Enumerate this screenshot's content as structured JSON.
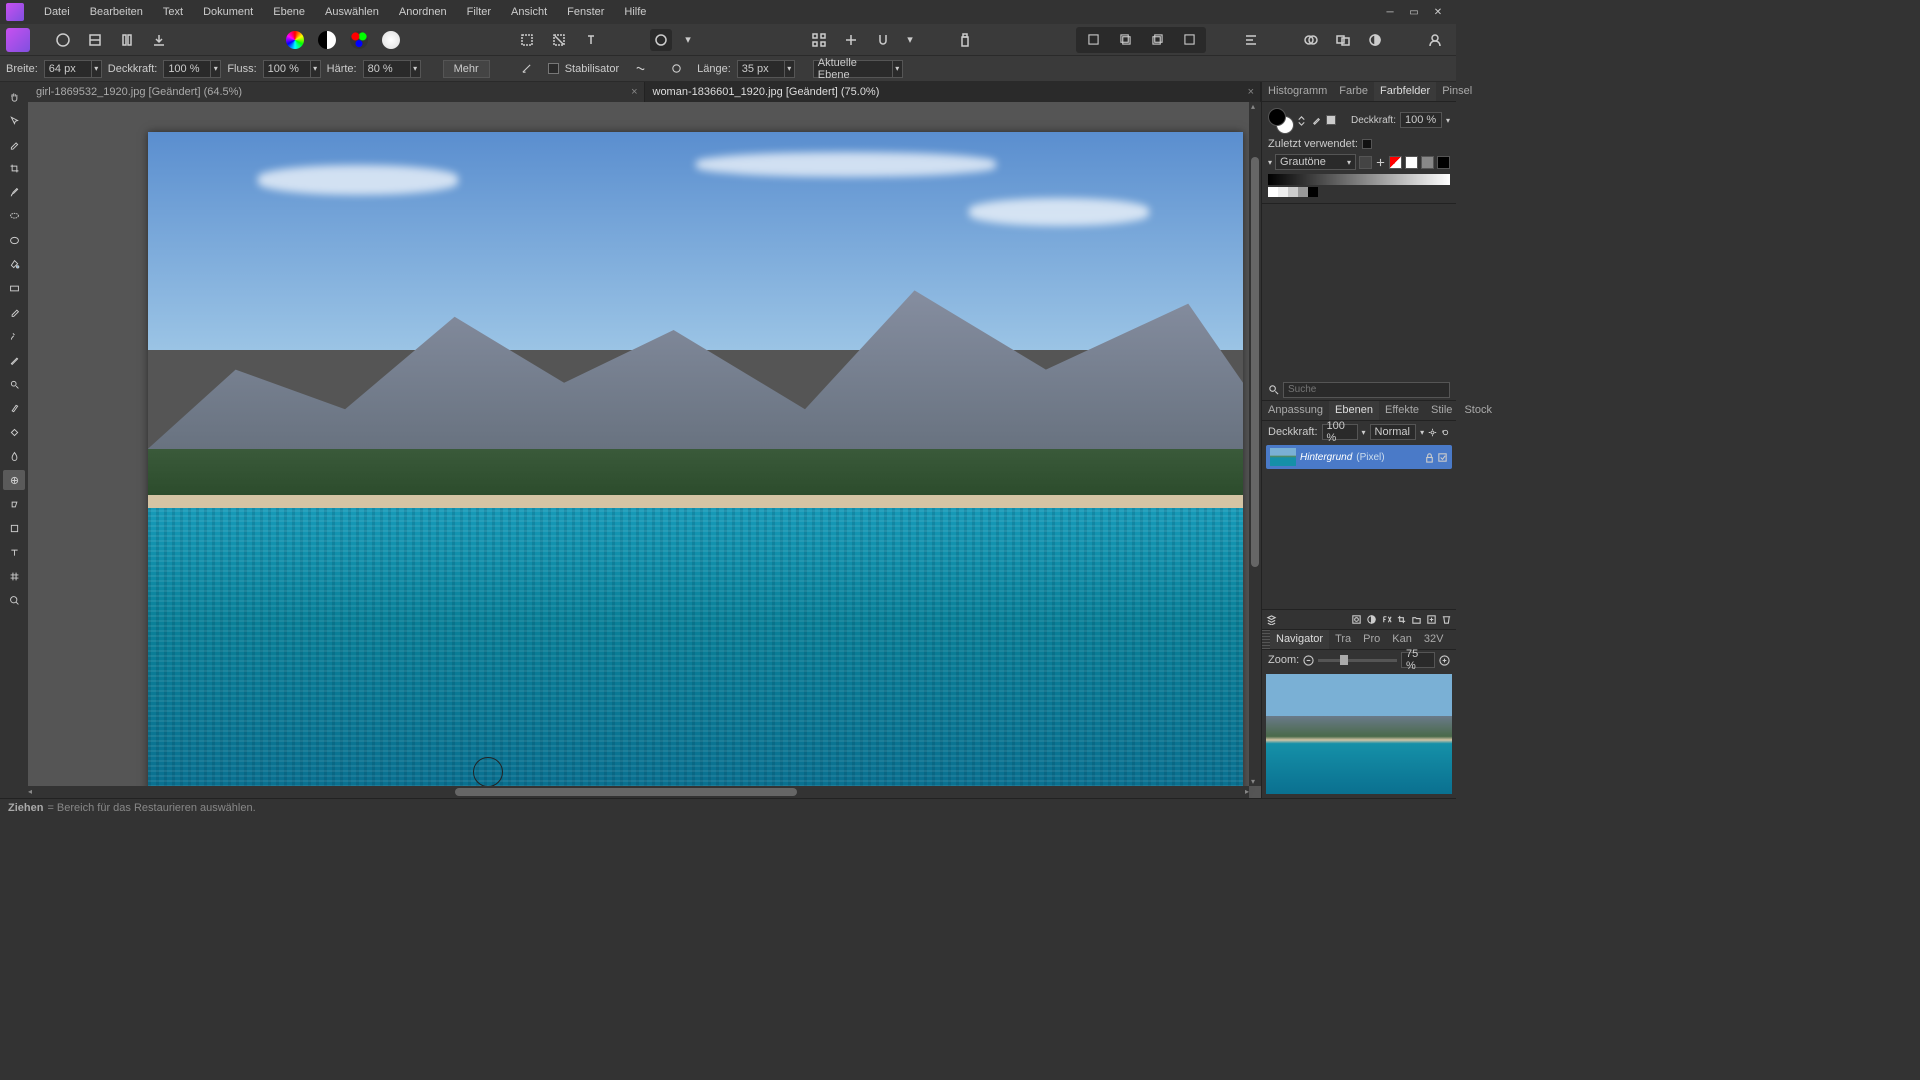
{
  "menu": [
    "Datei",
    "Bearbeiten",
    "Text",
    "Dokument",
    "Ebene",
    "Auswählen",
    "Anordnen",
    "Filter",
    "Ansicht",
    "Fenster",
    "Hilfe"
  ],
  "toolbar2": {
    "width_label": "Breite:",
    "width_value": "64 px",
    "opacity_label": "Deckkraft:",
    "opacity_value": "100 %",
    "flow_label": "Fluss:",
    "flow_value": "100 %",
    "hardness_label": "Härte:",
    "hardness_value": "80 %",
    "more": "Mehr",
    "stabilizer": "Stabilisator",
    "length_label": "Länge:",
    "length_value": "35 px",
    "target": "Aktuelle Ebene"
  },
  "tabs": [
    {
      "label": "girl-1869532_1920.jpg [Geändert] (64.5%)",
      "active": false
    },
    {
      "label": "woman-1836601_1920.jpg [Geändert] (75.0%)",
      "active": true
    }
  ],
  "right": {
    "top_tabs": [
      "Histogramm",
      "Farbe",
      "Farbfelder",
      "Pinsel"
    ],
    "top_active": "Farbfelder",
    "opacity_label": "Deckkraft:",
    "opacity_value": "100 %",
    "recent_label": "Zuletzt verwendet:",
    "palette": "Grautöne",
    "search_placeholder": "Suche",
    "mid_tabs": [
      "Anpassung",
      "Ebenen",
      "Effekte",
      "Stile",
      "Stock"
    ],
    "mid_active": "Ebenen",
    "lay_opacity_label": "Deckkraft:",
    "lay_opacity_value": "100 %",
    "blend": "Normal",
    "layer_name": "Hintergrund",
    "layer_type": "(Pixel)",
    "nav_tabs": [
      "Navigator",
      "Tra",
      "Pro",
      "Kan",
      "32V"
    ],
    "nav_active": "Navigator",
    "zoom_label": "Zoom:",
    "zoom_value": "75 %"
  },
  "status": {
    "action": "Ziehen",
    "hint": "= Bereich für das Restaurieren auswählen."
  }
}
